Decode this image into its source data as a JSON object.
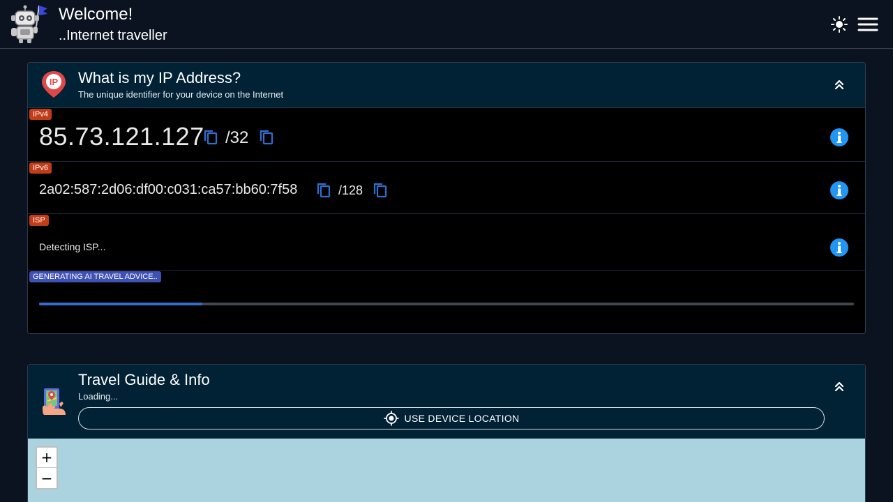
{
  "header": {
    "welcome": "Welcome!",
    "subtitle": "..Internet traveller",
    "logo_icon": "robot-flag-icon",
    "theme_icon": "sun-icon",
    "menu_icon": "hamburger-menu-icon"
  },
  "ip_card": {
    "title": "What is my IP Address?",
    "description": "The unique identifier for your device on the Internet",
    "icon": "ip-location-pin-icon",
    "collapse_icon": "chevron-double-up-icon",
    "ipv4": {
      "badge": "IPv4",
      "value": "85.73.121.127",
      "prefix": "/32"
    },
    "ipv6": {
      "badge": "IPv6",
      "value": "2a02:587:2d06:df00:c031:ca57:bb60:7f58",
      "prefix": "/128"
    },
    "isp": {
      "badge": "ISP",
      "value": "Detecting ISP..."
    },
    "ai": {
      "badge": "GENERATING AI TRAVEL ADVICE..",
      "progress": 0.2
    }
  },
  "travel_card": {
    "title": "Travel Guide & Info",
    "status": "Loading...",
    "icon": "map-hand-icon",
    "collapse_icon": "chevron-double-up-icon",
    "location_button": "USE DEVICE LOCATION",
    "location_icon": "crosshair-gps-icon"
  },
  "map": {
    "zoom_in": "+",
    "zoom_out": "−"
  },
  "colors": {
    "background": "#0b1220",
    "card_header": "#012235",
    "badge_red": "#c23d17",
    "badge_blue": "#3f51b5",
    "accent_blue": "#2196f3",
    "copy_blue": "#2f6fd0",
    "map_water": "#aad3df"
  }
}
